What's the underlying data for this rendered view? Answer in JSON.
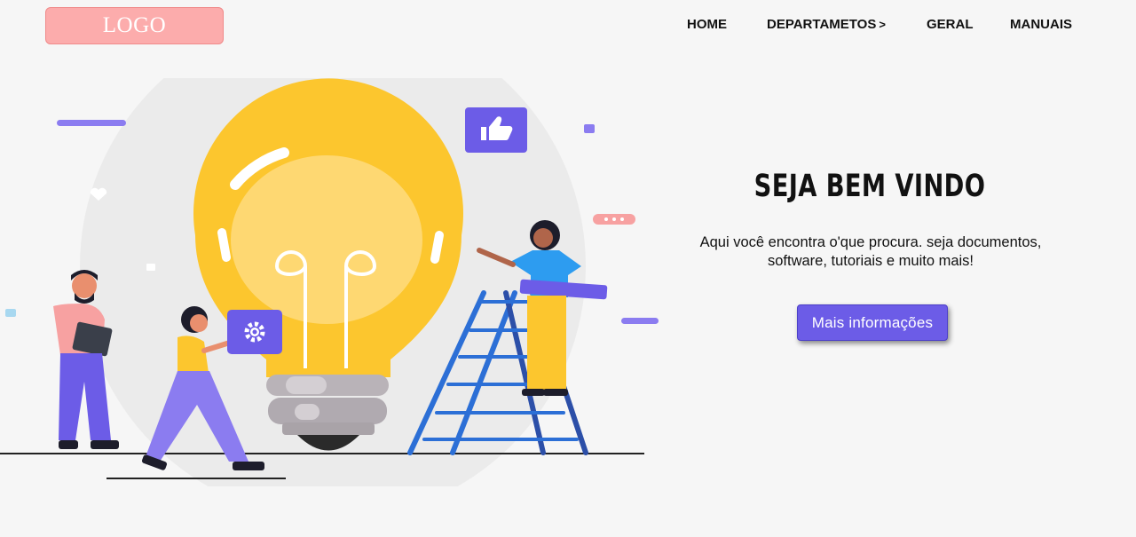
{
  "header": {
    "logo_text": "LOGO",
    "nav": {
      "home": "HOME",
      "departamentos": "DEPARTAMETOS",
      "departamentos_chevron": ">",
      "geral": "GERAL",
      "manuais": "MANUAIS"
    }
  },
  "hero": {
    "title": "SEJA BEM VINDO",
    "description_line1": "Aqui você encontra o'que procura. seja documentos,",
    "description_line2": "software, tutoriais e muito mais!",
    "button_label": "Mais informações"
  },
  "colors": {
    "logo_bg": "#fcacac",
    "accent_purple": "#6c5ce7",
    "bulb_yellow": "#fcc62e",
    "ladder_blue": "#2c6fd6",
    "page_bg": "#f6f6f6"
  },
  "illustration": {
    "name": "teamwork-lightbulb-illustration",
    "icons": [
      "thumbs-up-icon",
      "gear-icon",
      "heart-icon",
      "chat-bubble-icon"
    ]
  }
}
